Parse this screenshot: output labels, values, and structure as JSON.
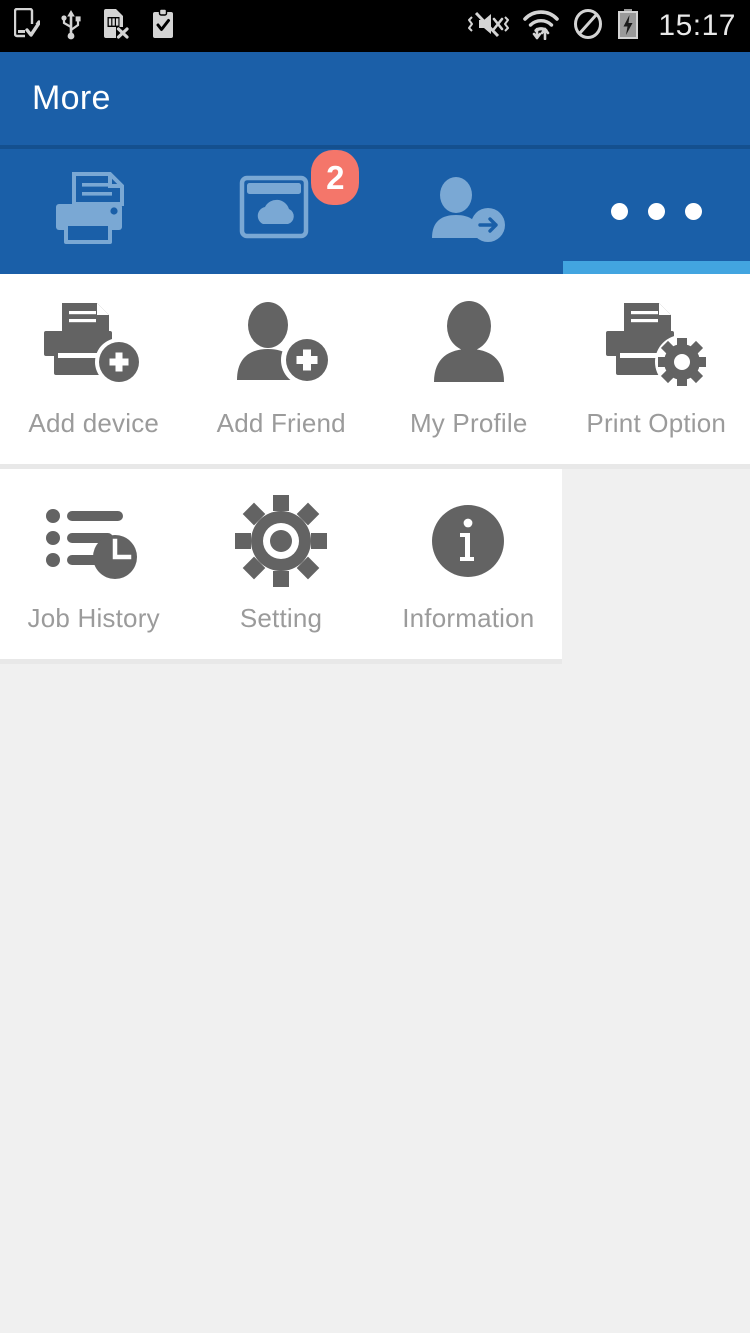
{
  "statusbar": {
    "time": "15:17",
    "left_icons": [
      {
        "name": "phone-download-icon"
      },
      {
        "name": "usb-icon"
      },
      {
        "name": "sim-card-error-icon"
      },
      {
        "name": "clipboard-check-icon"
      }
    ],
    "right_icons": [
      {
        "name": "vibrate-mute-icon"
      },
      {
        "name": "wifi-transfer-icon"
      },
      {
        "name": "do-not-disturb-icon"
      },
      {
        "name": "battery-charging-icon"
      }
    ]
  },
  "header": {
    "title": "More",
    "background": "#1b5fa8"
  },
  "tabs": [
    {
      "name": "tab-printer",
      "icon": "printer-icon",
      "badge": null,
      "active": false
    },
    {
      "name": "tab-cloud",
      "icon": "window-cloud-icon",
      "badge": "2",
      "active": false
    },
    {
      "name": "tab-send-friend",
      "icon": "person-arrow-icon",
      "badge": null,
      "active": false
    },
    {
      "name": "tab-more",
      "icon": "more-dots-icon",
      "badge": null,
      "active": true
    }
  ],
  "tab_indicator_color": "#42a5e0",
  "badge_color": "#f4766a",
  "grid": {
    "rows": [
      [
        {
          "label": "Add device",
          "icon": "printer-add-icon"
        },
        {
          "label": "Add Friend",
          "icon": "person-add-icon"
        },
        {
          "label": "My Profile",
          "icon": "person-icon"
        },
        {
          "label": "Print Option",
          "icon": "printer-gear-icon"
        }
      ],
      [
        {
          "label": "Job History",
          "icon": "list-clock-icon"
        },
        {
          "label": "Setting",
          "icon": "gear-icon"
        },
        {
          "label": "Information",
          "icon": "info-circle-icon"
        }
      ]
    ],
    "label_color": "#9b9b9b",
    "icon_color": "#636363"
  }
}
